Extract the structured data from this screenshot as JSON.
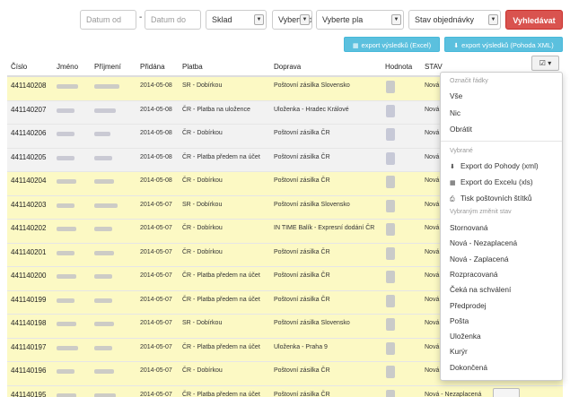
{
  "filters": {
    "date_from_placeholder": "Datum od",
    "separator": "-",
    "date_to_placeholder": "Datum do",
    "warehouse": "Sklad",
    "shipping": "Vyberte dop",
    "payment": "Vyberte pla",
    "status": "Stav objednávky",
    "search_button": "Vyhledávat"
  },
  "exports": {
    "excel": "export výsledků (Excel)",
    "pohoda": "export výsledků (Pohoda XML)"
  },
  "columns": [
    "Číslo",
    "Jméno",
    "Příjmení",
    "Přidána",
    "Platba",
    "Doprava",
    "Hodnota",
    "STAV"
  ],
  "rows": [
    {
      "id": "441140208",
      "date": "2014-05-08",
      "payment": "SR - Dobírkou",
      "shipping": "Poštovní zásilka Slovensko",
      "status": "Nová"
    },
    {
      "id": "441140207",
      "date": "2014-05-08",
      "payment": "ČR - Platba na uložence",
      "shipping": "Uloženka - Hradec Králové",
      "status": "Nová"
    },
    {
      "id": "441140206",
      "date": "2014-05-08",
      "payment": "ČR - Dobírkou",
      "shipping": "Poštovní zásilka ČR",
      "status": "Nová"
    },
    {
      "id": "441140205",
      "date": "2014-05-08",
      "payment": "ČR - Platba předem na účet",
      "shipping": "Poštovní zásilka ČR",
      "status": "Nová"
    },
    {
      "id": "441140204",
      "date": "2014-05-08",
      "payment": "ČR - Dobírkou",
      "shipping": "Poštovní zásilka ČR",
      "status": "Nová"
    },
    {
      "id": "441140203",
      "date": "2014-05-07",
      "payment": "SR - Dobírkou",
      "shipping": "Poštovní zásilka Slovensko",
      "status": "Nová"
    },
    {
      "id": "441140202",
      "date": "2014-05-07",
      "payment": "ČR - Dobírkou",
      "shipping": "IN TIME Balík - Expresní dodání ČR",
      "status": "Nová"
    },
    {
      "id": "441140201",
      "date": "2014-05-07",
      "payment": "ČR - Dobírkou",
      "shipping": "Poštovní zásilka ČR",
      "status": "Nová"
    },
    {
      "id": "441140200",
      "date": "2014-05-07",
      "payment": "ČR - Platba předem na účet",
      "shipping": "Poštovní zásilka ČR",
      "status": "Nová"
    },
    {
      "id": "441140199",
      "date": "2014-05-07",
      "payment": "ČR - Platba předem na účet",
      "shipping": "Poštovní zásilka ČR",
      "status": "Nová"
    },
    {
      "id": "441140198",
      "date": "2014-05-07",
      "payment": "SR - Dobírkou",
      "shipping": "Poštovní zásilka Slovensko",
      "status": "Nová"
    },
    {
      "id": "441140197",
      "date": "2014-05-07",
      "payment": "ČR - Platba předem na účet",
      "shipping": "Uloženka - Praha 9",
      "status": "Nová"
    },
    {
      "id": "441140196",
      "date": "2014-05-07",
      "payment": "ČR - Dobírkou",
      "shipping": "Poštovní zásilka ČR",
      "status": "Nová"
    },
    {
      "id": "441140195",
      "date": "2014-05-07",
      "payment": "ČR - Platba předem na účet",
      "shipping": "Poštovní zásilka ČR",
      "status": "Nová - Nezaplacená"
    }
  ],
  "menu": {
    "header_mark": "Označit řádky",
    "all": "Vše",
    "none": "Nic",
    "invert": "Obrátit",
    "header_selected": "Vybrané",
    "export_pohoda": "Export do Pohody (xml)",
    "export_excel": "Export do Excelu (xls)",
    "print_labels": "Tisk poštovních štítků",
    "header_change": "Vybraným změnit stav",
    "states": [
      "Stornovaná",
      "Nová - Nezaplacená",
      "Nová - Zaplacená",
      "Rozpracovaná",
      "Čeká na schválení",
      "Předprodej",
      "Pošta",
      "Uloženka",
      "Kurýr",
      "Dokončená"
    ]
  },
  "colors": {
    "accent": "#d9534f",
    "info": "#5bc0de",
    "row_highlight": "#fcf9c4"
  }
}
